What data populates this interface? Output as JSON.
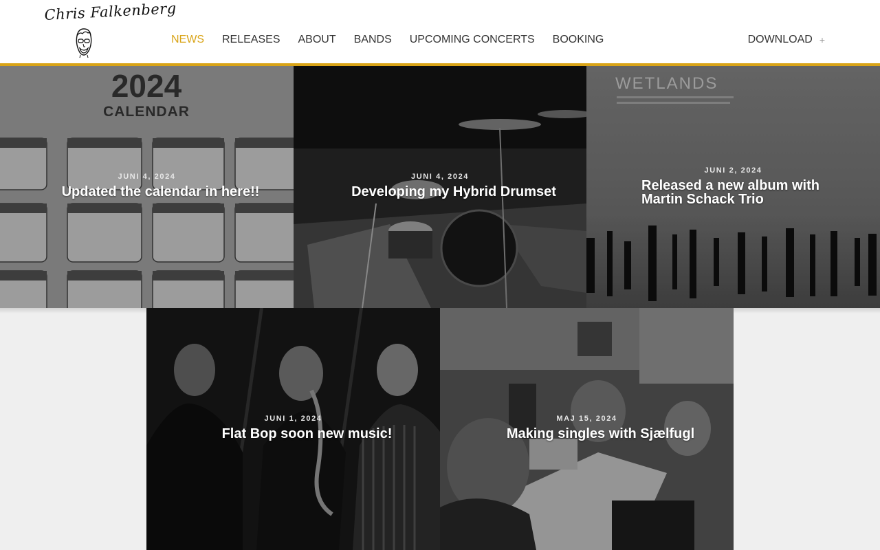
{
  "header": {
    "logo_text": "Chris Falkenberg",
    "nav": [
      {
        "label": "NEWS",
        "active": true
      },
      {
        "label": "RELEASES",
        "active": false
      },
      {
        "label": "ABOUT",
        "active": false
      },
      {
        "label": "BANDS",
        "active": false
      },
      {
        "label": "UPCOMING CONCERTS",
        "active": false
      },
      {
        "label": "BOOKING",
        "active": false
      }
    ],
    "download_label": "DOWNLOAD",
    "download_icon": "plus-icon",
    "accent_color": "#d9a417"
  },
  "posts": [
    {
      "date": "JUNI 4, 2024",
      "title": "Updated the calendar in here!!",
      "image": "calendar-2024",
      "image_text": "2024",
      "image_subtext": "CALENDAR"
    },
    {
      "date": "JUNI 4, 2024",
      "title": "Developing my Hybrid Drumset",
      "image": "drumset-photo"
    },
    {
      "date": "JUNI 2, 2024",
      "title": "Released a new album with Martin Schack Trio",
      "image": "wetlands-album-cover",
      "image_text": "WETLANDS"
    },
    {
      "date": "JUNI 1, 2024",
      "title": "Flat Bop soon new music!",
      "image": "band-portraits"
    },
    {
      "date": "MAJ 15, 2024",
      "title": "Making singles with Sjælfugl",
      "image": "studio-group-selfie"
    }
  ]
}
